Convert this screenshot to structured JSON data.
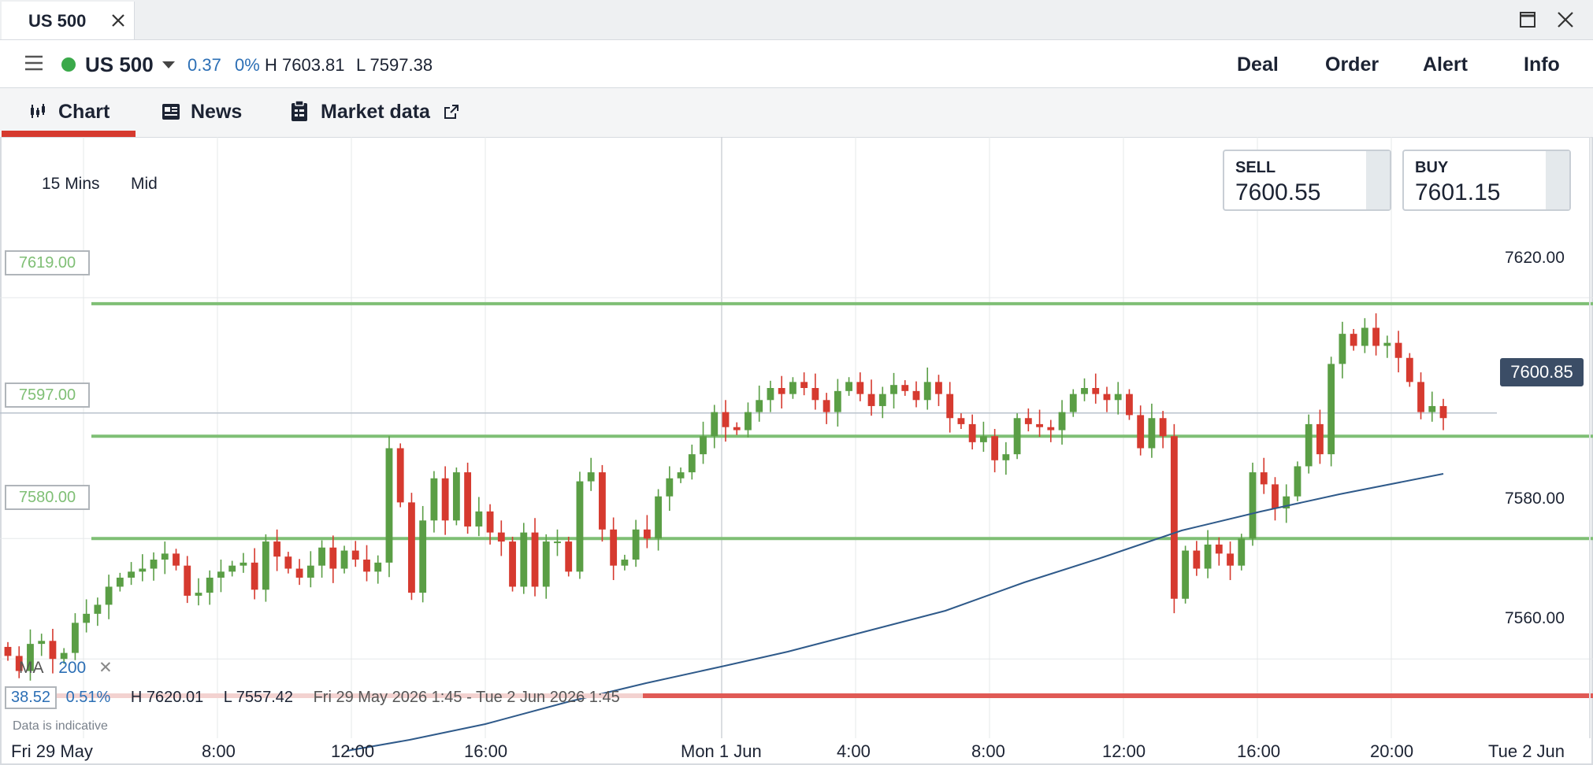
{
  "window": {
    "tab_title": "US 500"
  },
  "header": {
    "instrument": "US 500",
    "change": "0.37",
    "change_pct": "0%",
    "high": "H 7603.81",
    "low": "L 7597.38",
    "actions": [
      "Deal",
      "Order",
      "Alert",
      "Info"
    ]
  },
  "tabs": [
    {
      "label": "Chart",
      "icon": "candlestick-icon",
      "active": true
    },
    {
      "label": "News",
      "icon": "news-icon",
      "active": false
    },
    {
      "label": "Market data",
      "icon": "clipboard-icon",
      "active": false,
      "external": true
    }
  ],
  "chart_controls": {
    "timeframe": "15 Mins",
    "price_type": "Mid"
  },
  "prices": {
    "sell_label": "SELL",
    "sell_value": "7600.55",
    "buy_label": "BUY",
    "buy_value": "7601.15",
    "current": "7600.85"
  },
  "levels": [
    "7619.00",
    "7597.00",
    "7580.00"
  ],
  "indicator": {
    "name": "MA",
    "period": "200"
  },
  "range_stats": {
    "change": "38.52",
    "change_pct": "0.51%",
    "high": "H 7620.01",
    "low": "L 7557.42",
    "period": "Fri 29 May 2026 1:45 - Tue 2 Jun 2026 1:45"
  },
  "disclaimer": "Data is indicative",
  "colors": {
    "up": "#5a9e45",
    "down": "#d63a2f",
    "level_line": "#7fbf75",
    "ma_line": "#2f5a8a",
    "status": "#3aa94a",
    "change_text": "#2c6fb5"
  },
  "chart_data": {
    "type": "candlestick",
    "y_ticks": [
      "7620.00",
      "7580.00",
      "7560.00"
    ],
    "x_ticks": [
      "Fri 29 May",
      "8:00",
      "12:00",
      "16:00",
      "Mon 1 Jun",
      "4:00",
      "8:00",
      "12:00",
      "16:00",
      "20:00",
      "Tue 2 Jun"
    ],
    "ylim": [
      7545,
      7630
    ],
    "levels": [
      7619.0,
      7597.0,
      7580.0
    ],
    "current_price": 7600.85,
    "close": [
      7560.5,
      7558,
      7562.5,
      7563,
      7560,
      7561,
      7566,
      7567.5,
      7569,
      7572,
      7573.5,
      7574.5,
      7575,
      7576.5,
      7577.5,
      7575.5,
      7570.5,
      7571,
      7573.5,
      7574.5,
      7575.5,
      7576,
      7571.5,
      7579.5,
      7577,
      7575,
      7573.5,
      7575.5,
      7578.5,
      7575,
      7578,
      7576.5,
      7574.5,
      7576,
      7595,
      7586,
      7571,
      7583,
      7590,
      7583,
      7591,
      7582,
      7584.5,
      7581,
      7579.5,
      7572,
      7581,
      7572,
      7579.5,
      7579.5,
      7574.5,
      7589.5,
      7591,
      7581.5,
      7575.5,
      7576.5,
      7581.5,
      7580,
      7587,
      7590,
      7591,
      7594,
      7597,
      7601,
      7598.5,
      7598,
      7601,
      7603,
      7605,
      7604,
      7606,
      7605,
      7603,
      7601,
      7604.5,
      7606,
      7604,
      7602,
      7604,
      7605.5,
      7604.5,
      7603,
      7606,
      7604,
      7600,
      7599,
      7596,
      7597,
      7593,
      7594,
      7600,
      7599,
      7598.5,
      7598,
      7601,
      7604,
      7605,
      7604,
      7603,
      7604,
      7600.5,
      7595,
      7600,
      7597,
      7570,
      7578,
      7575,
      7579,
      7577.5,
      7575.5,
      7580,
      7591,
      7589,
      7585,
      7587,
      7592,
      7599,
      7594,
      7609,
      7614,
      7612,
      7615,
      7612,
      7612.5,
      7610,
      7606,
      7601,
      7602,
      7600
    ]
  }
}
